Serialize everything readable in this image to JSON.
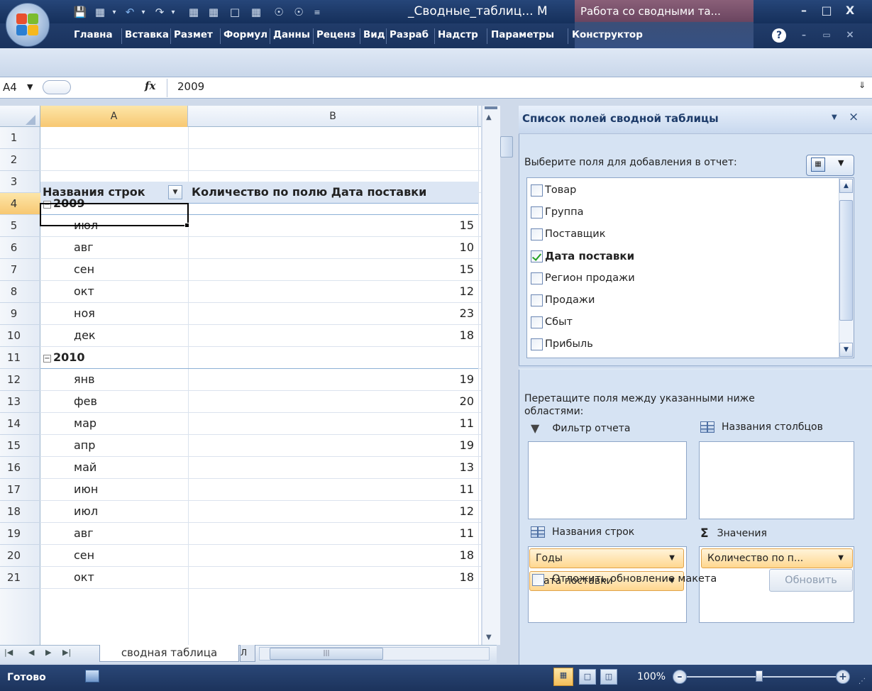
{
  "window": {
    "title": "_Сводные_таблиц... M",
    "context_tab_group": "Работа со сводными та...",
    "buttons": {
      "minimize": "–",
      "maximize": "□",
      "close": "X"
    }
  },
  "ribbon": {
    "tabs": [
      "Главна",
      "Вставка",
      "Размет",
      "Формул",
      "Данны",
      "Реценз",
      "Вид",
      "Разраб",
      "Надстр",
      "Параметры",
      "Конструктор"
    ],
    "help": "?"
  },
  "formula_bar": {
    "name_box": "A4",
    "fx": "fx",
    "value": "2009"
  },
  "sheet": {
    "columns": [
      "A",
      "B"
    ],
    "row_numbers": [
      "1",
      "2",
      "3",
      "4",
      "5",
      "6",
      "7",
      "8",
      "9",
      "10",
      "11",
      "12",
      "13",
      "14",
      "15",
      "16",
      "17",
      "18",
      "19",
      "20",
      "21"
    ],
    "selected_row": "4",
    "header": {
      "row_labels": "Названия строк",
      "values": "Количество по полю Дата поставки"
    },
    "groups": [
      {
        "year": "2009",
        "rows": [
          {
            "month": "июл",
            "count": "15"
          },
          {
            "month": "авг",
            "count": "10"
          },
          {
            "month": "сен",
            "count": "15"
          },
          {
            "month": "окт",
            "count": "12"
          },
          {
            "month": "ноя",
            "count": "23"
          },
          {
            "month": "дек",
            "count": "18"
          }
        ]
      },
      {
        "year": "2010",
        "rows": [
          {
            "month": "янв",
            "count": "19"
          },
          {
            "month": "фев",
            "count": "20"
          },
          {
            "month": "мар",
            "count": "11"
          },
          {
            "month": "апр",
            "count": "19"
          },
          {
            "month": "май",
            "count": "13"
          },
          {
            "month": "июн",
            "count": "11"
          },
          {
            "month": "июл",
            "count": "12"
          },
          {
            "month": "авг",
            "count": "11"
          },
          {
            "month": "сен",
            "count": "18"
          },
          {
            "month": "окт",
            "count": "18"
          }
        ]
      }
    ],
    "sheet_tab": "сводная таблица",
    "sheet_tab2": "Л"
  },
  "status": {
    "text": "Готово",
    "zoom": "100%"
  },
  "pivot_pane": {
    "title": "Список полей сводной таблицы",
    "choose_label": "Выберите поля для добавления в отчет:",
    "fields": [
      {
        "label": "Товар",
        "checked": false
      },
      {
        "label": "Группа",
        "checked": false
      },
      {
        "label": "Поставщик",
        "checked": false
      },
      {
        "label": "Дата поставки",
        "checked": true
      },
      {
        "label": "Регион продажи",
        "checked": false
      },
      {
        "label": "Продажи",
        "checked": false
      },
      {
        "label": "Сбыт",
        "checked": false
      },
      {
        "label": "Прибыль",
        "checked": false
      }
    ],
    "drag_label": "Перетащите поля между указанными ниже областями:",
    "areas": {
      "report_filter": "Фильтр отчета",
      "column_labels": "Названия столбцов",
      "row_labels": "Названия строк",
      "values": "Значения"
    },
    "row_chips": [
      "Годы",
      "Дата поставки"
    ],
    "value_chips": [
      "Количество по п..."
    ],
    "defer_label": "Отложить обновление макета",
    "update_button": "Обновить",
    "sigma": "Σ"
  }
}
